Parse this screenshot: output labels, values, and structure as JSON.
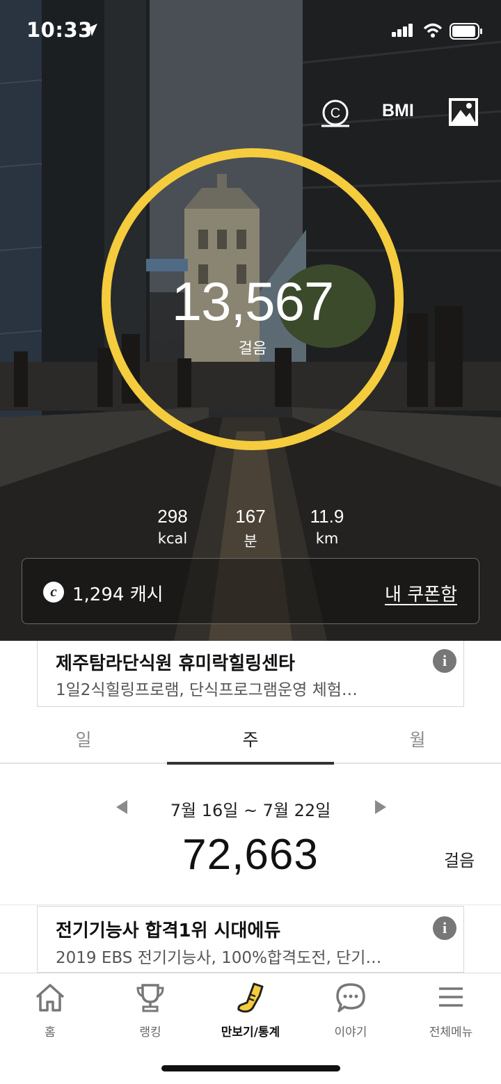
{
  "status_bar": {
    "time": "10:33"
  },
  "header": {
    "bmi_label": "BMI",
    "cash_icon": "cash-c-icon",
    "image_icon": "image-icon"
  },
  "steps": {
    "count": "13,567",
    "unit": "걸음"
  },
  "stats": [
    {
      "value": "298",
      "unit": "kcal"
    },
    {
      "value": "167",
      "unit": "분"
    },
    {
      "value": "11.9",
      "unit": "km"
    }
  ],
  "cash": {
    "coin_letter": "c",
    "amount": "1,294 캐시",
    "coupon_link": "내 쿠폰함"
  },
  "ads": [
    {
      "title": "제주탐라단식원 휴미락힐링센타",
      "desc": "1일2식힐링프로램, 단식프로그램운영 체험…",
      "info": "i"
    },
    {
      "title": "전기기능사 합격1위 시대에듀",
      "desc": "2019 EBS 전기기능사, 100%합격도전, 단기…",
      "info": "i"
    }
  ],
  "period_tabs": [
    {
      "label": "일",
      "active": false
    },
    {
      "label": "주",
      "active": true
    },
    {
      "label": "월",
      "active": false
    }
  ],
  "week": {
    "range": "7월 16일 ~ 7월 22일",
    "total": "72,663",
    "unit": "걸음"
  },
  "bottom_nav": [
    {
      "label": "홈",
      "icon": "home-icon"
    },
    {
      "label": "랭킹",
      "icon": "trophy-icon"
    },
    {
      "label": "만보기/통계",
      "icon": "shoe-icon",
      "active": true
    },
    {
      "label": "이야기",
      "icon": "chat-bubble-icon"
    },
    {
      "label": "전체메뉴",
      "icon": "hamburger-menu-icon"
    }
  ],
  "colors": {
    "ring": "#f4cc3d",
    "accent": "#f4cc3d"
  }
}
